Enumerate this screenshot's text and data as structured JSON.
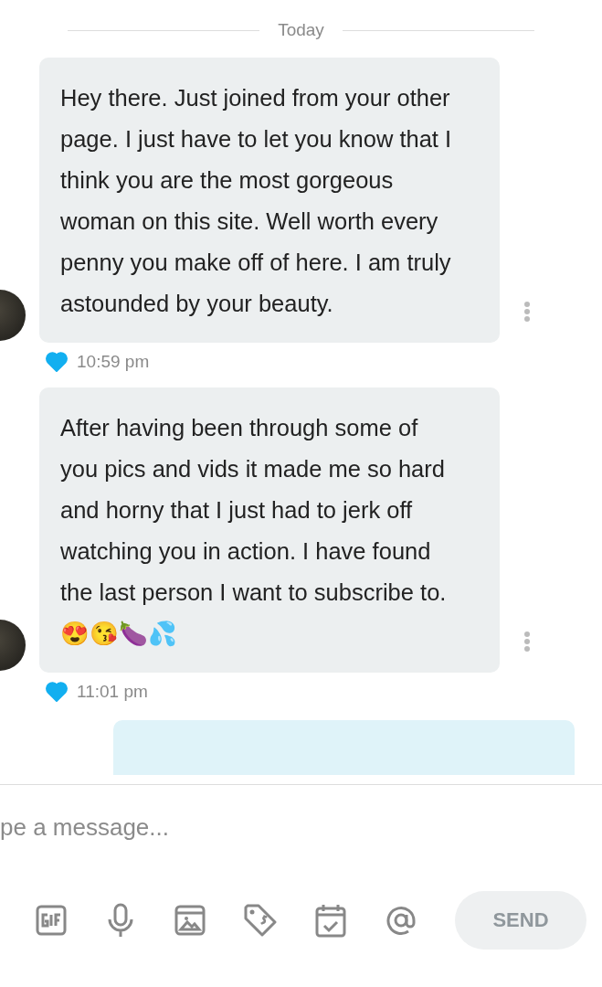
{
  "date_divider": "Today",
  "messages": [
    {
      "kind": "incoming",
      "text": "Hey there. Just joined from your other page. I just have to let you know that I think you are the most gorgeous woman on this site. Well worth every penny you make off of here. I am truly astounded by your beauty.",
      "time": "10:59 pm",
      "liked": true
    },
    {
      "kind": "incoming",
      "text": "After having been through some of you pics and vids it made me so hard and horny that I just had to jerk off watching you in action. I have found the last person I want to subscribe to. 😍😘🍆💦",
      "time": "11:01 pm",
      "liked": true
    },
    {
      "kind": "outgoing"
    }
  ],
  "composer": {
    "placeholder": "pe a message...",
    "send": "SEND",
    "send_disabled": true
  }
}
